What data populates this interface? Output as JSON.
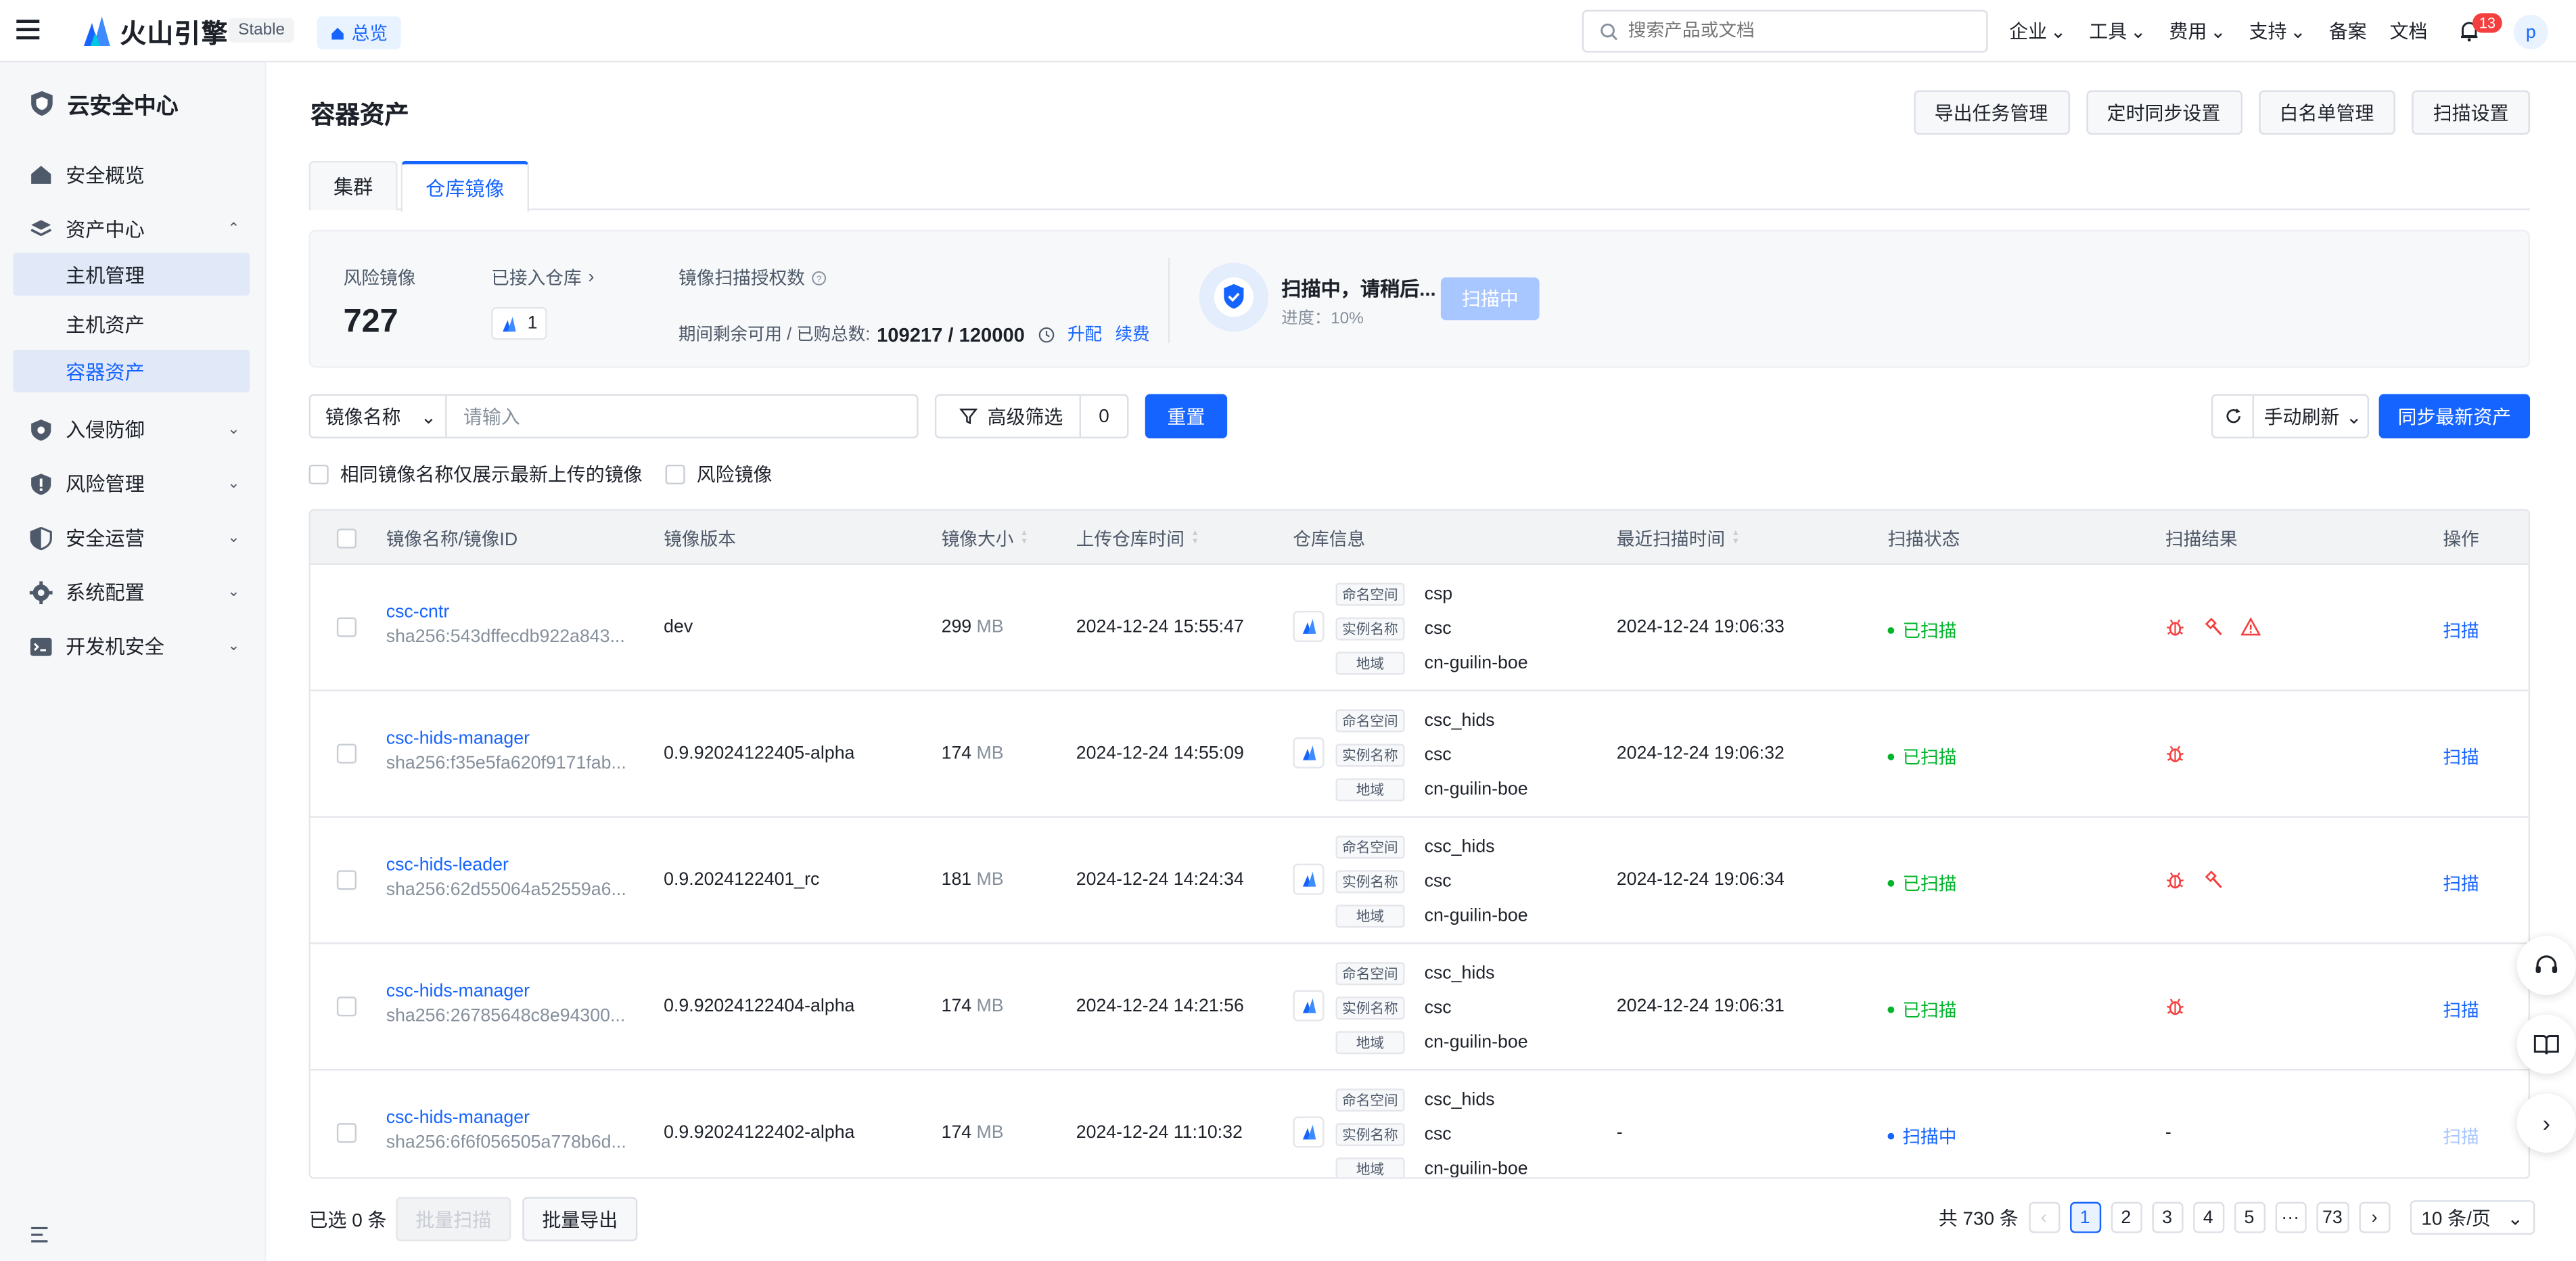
{
  "topnav": {
    "brand": "火山引擎",
    "stable_tag": "Stable",
    "overview_tag": "总览",
    "search_placeholder": "搜索产品或文档",
    "menu": [
      "企业",
      "工具",
      "费用",
      "支持",
      "备案",
      "文档"
    ],
    "notification_count": "13",
    "avatar_letter": "p"
  },
  "sidebar": {
    "title": "云安全中心",
    "items": [
      {
        "label": "安全概览",
        "icon": "home-icon"
      },
      {
        "label": "资产中心",
        "icon": "layers-icon",
        "expanded": true
      },
      {
        "label": "入侵防御",
        "icon": "shield-icon"
      },
      {
        "label": "风险管理",
        "icon": "risk-shield-icon"
      },
      {
        "label": "安全运营",
        "icon": "half-shield-icon"
      },
      {
        "label": "系统配置",
        "icon": "gear-icon"
      },
      {
        "label": "开发机安全",
        "icon": "terminal-icon"
      }
    ],
    "sub_items": [
      "主机管理",
      "主机资产",
      "容器资产"
    ]
  },
  "page": {
    "title": "容器资产",
    "buttons": [
      "导出任务管理",
      "定时同步设置",
      "白名单管理",
      "扫描设置"
    ],
    "tabs": [
      "集群",
      "仓库镜像"
    ],
    "active_tab": "仓库镜像"
  },
  "stats": {
    "risk_label": "风险镜像",
    "risk_value": "727",
    "repo_label": "已接入仓库",
    "repo_count": "1",
    "quota_label": "镜像扫描授权数",
    "quota_text": "期间剩余可用 / 已购总数:",
    "quota_value": "109217 / 120000",
    "upgrade": "升配",
    "renew": "续费",
    "scan_title": "扫描中，请稍后...",
    "scan_progress": "进度：10%",
    "scan_button": "扫描中"
  },
  "filters": {
    "field_select": "镜像名称",
    "input_placeholder": "请输入",
    "advanced": "高级筛选",
    "advanced_count": "0",
    "reset": "重置",
    "refresh_mode": "手动刷新",
    "sync": "同步最新资产",
    "check_latest": "相同镜像名称仅展示最新上传的镜像",
    "check_risk": "风险镜像"
  },
  "table": {
    "columns": [
      "镜像名称/镜像ID",
      "镜像版本",
      "镜像大小",
      "上传仓库时间",
      "仓库信息",
      "最近扫描时间",
      "扫描状态",
      "扫描结果",
      "操作"
    ],
    "repo_keys": [
      "命名空间",
      "实例名称",
      "地域"
    ],
    "size_unit": "MB",
    "rows": [
      {
        "name": "csc-cntr",
        "id": "sha256:543dffecdb922a843...",
        "version": "dev",
        "size": "299",
        "upload": "2024-12-24 15:55:47",
        "ns": "csp",
        "inst": "csc",
        "region": "cn-guilin-boe",
        "scan_time": "2024-12-24 19:06:33",
        "status": "已扫描",
        "status_color": "#00b42a",
        "results": [
          "bug-icon",
          "hammer-icon",
          "warning-icon"
        ],
        "op": "扫描"
      },
      {
        "name": "csc-hids-manager",
        "id": "sha256:f35e5fa620f9171fab...",
        "version": "0.9.92024122405-alpha",
        "size": "174",
        "upload": "2024-12-24 14:55:09",
        "ns": "csc_hids",
        "inst": "csc",
        "region": "cn-guilin-boe",
        "scan_time": "2024-12-24 19:06:32",
        "status": "已扫描",
        "status_color": "#00b42a",
        "results": [
          "bug-icon"
        ],
        "op": "扫描"
      },
      {
        "name": "csc-hids-leader",
        "id": "sha256:62d55064a52559a6...",
        "version": "0.9.2024122401_rc",
        "size": "181",
        "upload": "2024-12-24 14:24:34",
        "ns": "csc_hids",
        "inst": "csc",
        "region": "cn-guilin-boe",
        "scan_time": "2024-12-24 19:06:34",
        "status": "已扫描",
        "status_color": "#00b42a",
        "results": [
          "bug-icon",
          "hammer-icon"
        ],
        "op": "扫描"
      },
      {
        "name": "csc-hids-manager",
        "id": "sha256:26785648c8e94300...",
        "version": "0.9.92024122404-alpha",
        "size": "174",
        "upload": "2024-12-24 14:21:56",
        "ns": "csc_hids",
        "inst": "csc",
        "region": "cn-guilin-boe",
        "scan_time": "2024-12-24 19:06:31",
        "status": "已扫描",
        "status_color": "#00b42a",
        "results": [
          "bug-icon"
        ],
        "op": "扫描"
      },
      {
        "name": "csc-hids-manager",
        "id": "sha256:6f6f056505a778b6d...",
        "version": "0.9.92024122402-alpha",
        "size": "174",
        "upload": "2024-12-24 11:10:32",
        "ns": "csc_hids",
        "inst": "csc",
        "region": "cn-guilin-boe",
        "scan_time": "-",
        "status": "扫描中",
        "status_color": "#1664ff",
        "results": [],
        "result_text": "-",
        "op": "扫描"
      }
    ]
  },
  "footer": {
    "selected": "已选 0 条",
    "batch_scan": "批量扫描",
    "batch_export": "批量导出",
    "total": "共 730 条",
    "pages": [
      "1",
      "2",
      "3",
      "4",
      "5",
      "···",
      "73"
    ],
    "page_size": "10 条/页"
  },
  "colors": {
    "accent": "#1664ff",
    "danger": "#f53f3f",
    "success": "#00b42a"
  }
}
